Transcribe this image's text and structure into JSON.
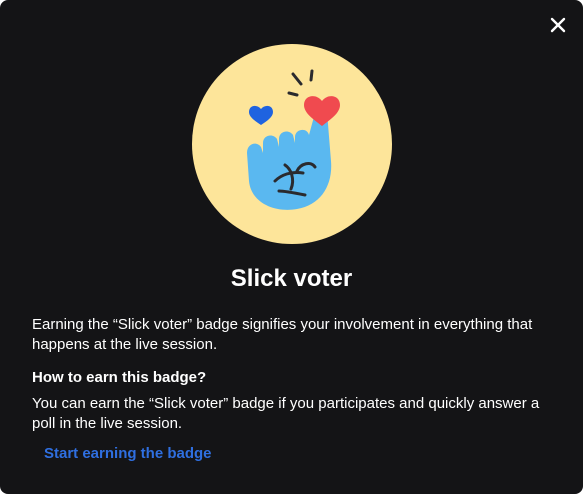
{
  "modal": {
    "close_icon": "close-icon",
    "badge_icon": "raised-finger-with-hearts",
    "title": "Slick voter",
    "description": "Earning the “Slick voter” badge signifies your involvement in everything that happens at the live session.",
    "how_to_title": "How to earn this badge?",
    "how_to_body": "You can earn the “Slick voter” badge if you participates and quickly answer a poll in the live session.",
    "cta_label": "Start earning the badge"
  },
  "colors": {
    "background": "#141416",
    "text": "#ffffff",
    "accent": "#2f6fe0",
    "badge_circle": "#fde59a",
    "hand": "#5ab8f0",
    "heart_red": "#f04a4f",
    "heart_blue": "#1f63e0"
  }
}
